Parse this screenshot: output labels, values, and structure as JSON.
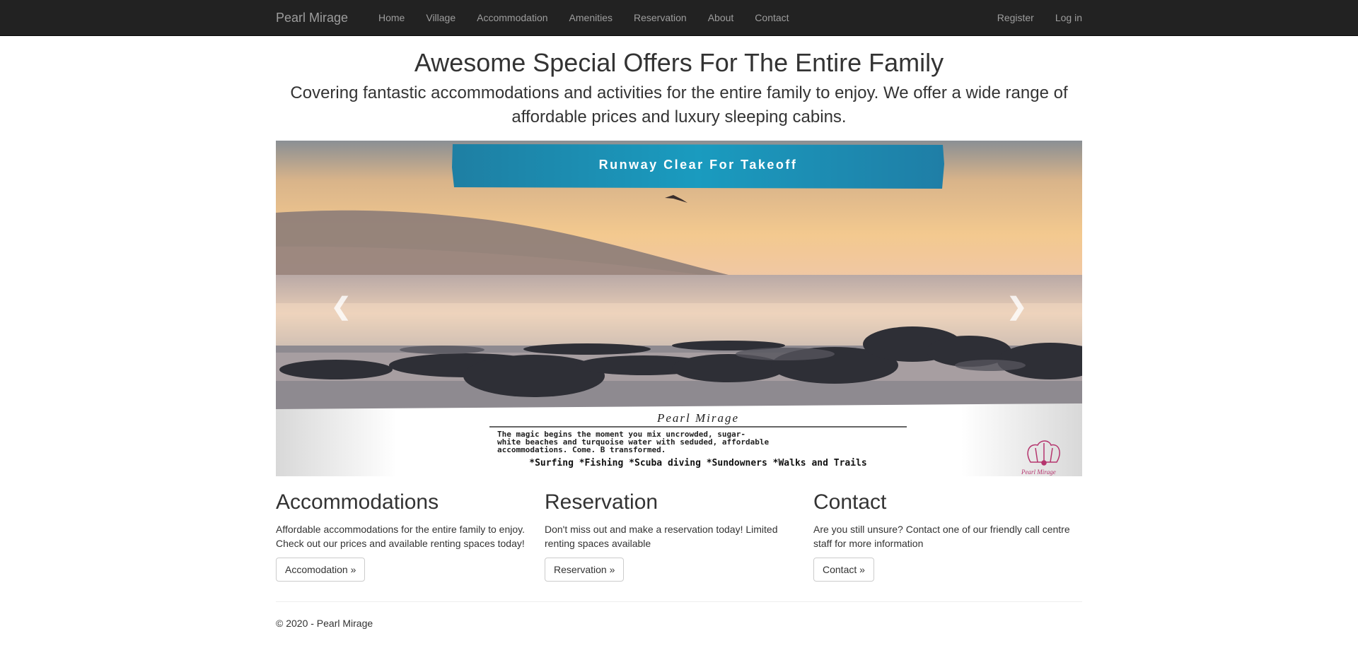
{
  "navbar": {
    "brand": "Pearl Mirage",
    "links": [
      "Home",
      "Village",
      "Accommodation",
      "Amenities",
      "Reservation",
      "About",
      "Contact"
    ],
    "right_links": [
      "Register",
      "Log in"
    ]
  },
  "hero": {
    "title": "Awesome Special Offers For The Entire Family",
    "lead": "Covering fantastic accommodations and activities for the entire family to enjoy. We offer a wide range of affordable prices and luxury sleeping cabins."
  },
  "carousel": {
    "banner_text": "Runway Clear For Takeoff",
    "caption_title": "Pearl Mirage",
    "caption_line1": "The magic begins the moment you mix uncrowded, sugar-",
    "caption_line2": "white beaches and turquoise water with seduded, affordable",
    "caption_line3": "accommodations. Come. B  transformed.",
    "activities": "*Surfing   *Fishing   *Scuba diving   *Sundowners   *Walks and Trails",
    "logo_text": "Pearl Mirage",
    "prev_icon": "chevron-left-icon",
    "next_icon": "chevron-right-icon"
  },
  "columns": [
    {
      "title": "Accommodations",
      "text": "Affordable accommodations for the entire family to enjoy. Check out our prices and available renting spaces today!",
      "button": "Accomodation »"
    },
    {
      "title": "Reservation",
      "text": "Don't miss out and make a reservation today! Limited renting spaces available",
      "button": "Reservation »"
    },
    {
      "title": "Contact",
      "text": "Are you still unsure? Contact one of our friendly call centre staff for more information",
      "button": "Contact »"
    }
  ],
  "footer": {
    "copyright": "© 2020 - Pearl Mirage"
  },
  "colors": {
    "navbar_bg": "#222222",
    "nav_text": "#9d9d9d",
    "banner_teal": "#1a8fb0"
  }
}
